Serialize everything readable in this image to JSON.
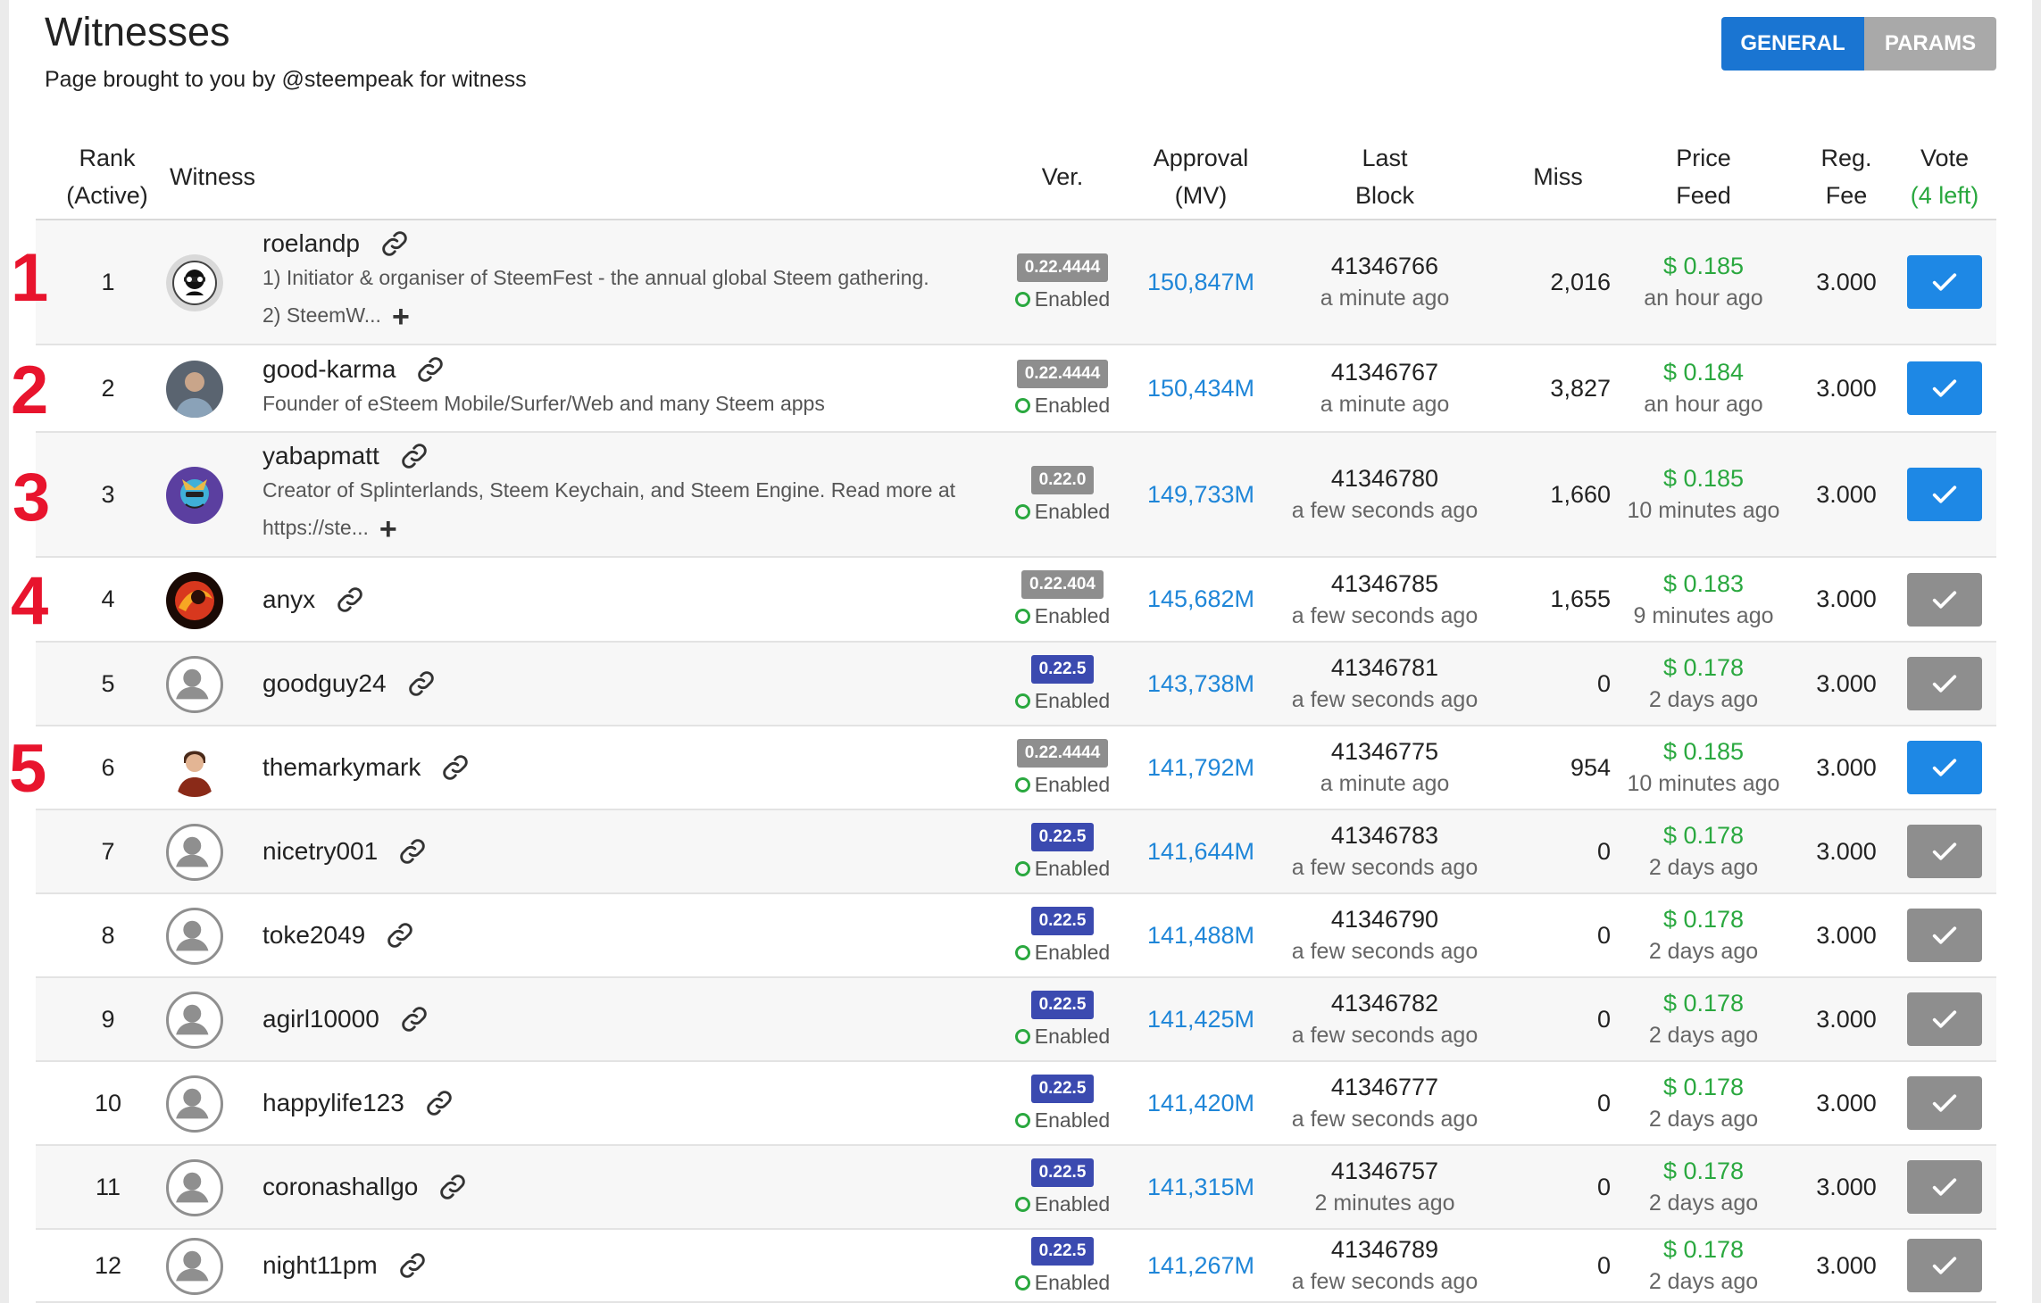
{
  "page": {
    "title": "Witnesses",
    "subtitle": "Page brought to you by @steempeak for witness",
    "tabs": [
      {
        "label": "GENERAL",
        "active": true
      },
      {
        "label": "PARAMS",
        "active": false
      }
    ]
  },
  "columns": {
    "rank": [
      "Rank",
      "(Active)"
    ],
    "witness": "Witness",
    "ver": "Ver.",
    "approval": [
      "Approval",
      "(MV)"
    ],
    "last_block": [
      "Last",
      "Block"
    ],
    "miss": "Miss",
    "price_feed": [
      "Price",
      "Feed"
    ],
    "reg_fee": [
      "Reg.",
      "Fee"
    ],
    "vote": [
      "Vote",
      "(4 left)"
    ]
  },
  "colors": {
    "accent": "#1a75d2",
    "vote_on": "#1e88e5",
    "vote_off": "#8e8e8e",
    "green": "#2aa83f",
    "approval": "#1f86d8",
    "annotation": "#e8142d"
  },
  "annotations": [
    "1",
    "2",
    "3",
    "4",
    "5"
  ],
  "rows": [
    {
      "rank": "1",
      "name": "roelandp",
      "desc": "1) Initiator & organiser of SteemFest - the annual global Steem gathering.",
      "desc2": "2) SteemW...",
      "ver": "0.22.4444",
      "status": "Enabled",
      "approval": "150,847M",
      "block": "41346766",
      "block_time": "a minute ago",
      "miss": "2,016",
      "price": "$ 0.185",
      "price_time": "an hour ago",
      "fee": "3.000",
      "voted": true
    },
    {
      "rank": "2",
      "name": "good-karma",
      "desc": "Founder of eSteem Mobile/Surfer/Web and many Steem apps",
      "ver": "0.22.4444",
      "status": "Enabled",
      "approval": "150,434M",
      "block": "41346767",
      "block_time": "a minute ago",
      "miss": "3,827",
      "price": "$ 0.184",
      "price_time": "an hour ago",
      "fee": "3.000",
      "voted": true
    },
    {
      "rank": "3",
      "name": "yabapmatt",
      "desc": "Creator of Splinterlands, Steem Keychain, and Steem Engine. Read more at",
      "desc2": "https://ste...",
      "ver": "0.22.0",
      "status": "Enabled",
      "approval": "149,733M",
      "block": "41346780",
      "block_time": "a few seconds ago",
      "miss": "1,660",
      "price": "$ 0.185",
      "price_time": "10 minutes ago",
      "fee": "3.000",
      "voted": true
    },
    {
      "rank": "4",
      "name": "anyx",
      "ver": "0.22.404",
      "status": "Enabled",
      "approval": "145,682M",
      "block": "41346785",
      "block_time": "a few seconds ago",
      "miss": "1,655",
      "price": "$ 0.183",
      "price_time": "9 minutes ago",
      "fee": "3.000",
      "voted": false
    },
    {
      "rank": "5",
      "name": "goodguy24",
      "ver": "0.22.5",
      "status": "Enabled",
      "approval": "143,738M",
      "block": "41346781",
      "block_time": "a few seconds ago",
      "miss": "0",
      "price": "$ 0.178",
      "price_time": "2 days ago",
      "fee": "3.000",
      "voted": false
    },
    {
      "rank": "6",
      "name": "themarkymark",
      "ver": "0.22.4444",
      "status": "Enabled",
      "approval": "141,792M",
      "block": "41346775",
      "block_time": "a minute ago",
      "miss": "954",
      "price": "$ 0.185",
      "price_time": "10 minutes ago",
      "fee": "3.000",
      "voted": true
    },
    {
      "rank": "7",
      "name": "nicetry001",
      "ver": "0.22.5",
      "status": "Enabled",
      "approval": "141,644M",
      "block": "41346783",
      "block_time": "a few seconds ago",
      "miss": "0",
      "price": "$ 0.178",
      "price_time": "2 days ago",
      "fee": "3.000",
      "voted": false
    },
    {
      "rank": "8",
      "name": "toke2049",
      "ver": "0.22.5",
      "status": "Enabled",
      "approval": "141,488M",
      "block": "41346790",
      "block_time": "a few seconds ago",
      "miss": "0",
      "price": "$ 0.178",
      "price_time": "2 days ago",
      "fee": "3.000",
      "voted": false
    },
    {
      "rank": "9",
      "name": "agirl10000",
      "ver": "0.22.5",
      "status": "Enabled",
      "approval": "141,425M",
      "block": "41346782",
      "block_time": "a few seconds ago",
      "miss": "0",
      "price": "$ 0.178",
      "price_time": "2 days ago",
      "fee": "3.000",
      "voted": false
    },
    {
      "rank": "10",
      "name": "happylife123",
      "ver": "0.22.5",
      "status": "Enabled",
      "approval": "141,420M",
      "block": "41346777",
      "block_time": "a few seconds ago",
      "miss": "0",
      "price": "$ 0.178",
      "price_time": "2 days ago",
      "fee": "3.000",
      "voted": false
    },
    {
      "rank": "11",
      "name": "coronashallgo",
      "ver": "0.22.5",
      "status": "Enabled",
      "approval": "141,315M",
      "block": "41346757",
      "block_time": "2 minutes ago",
      "miss": "0",
      "price": "$ 0.178",
      "price_time": "2 days ago",
      "fee": "3.000",
      "voted": false
    },
    {
      "rank": "12",
      "name": "night11pm",
      "ver": "0.22.5",
      "status": "Enabled",
      "approval": "141,267M",
      "block": "41346789",
      "block_time": "a few seconds ago",
      "miss": "0",
      "price": "$ 0.178",
      "price_time": "2 days ago",
      "fee": "3.000",
      "voted": false
    }
  ]
}
